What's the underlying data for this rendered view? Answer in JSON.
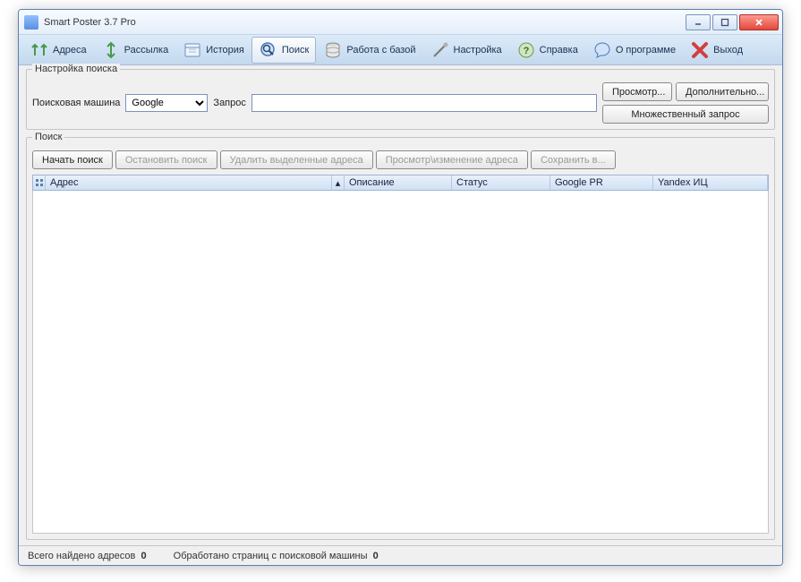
{
  "window": {
    "title": "Smart Poster 3.7 Pro"
  },
  "toolbar": {
    "addresses": "Адреса",
    "mailing": "Рассылка",
    "history": "История",
    "search": "Поиск",
    "database": "Работа с базой",
    "settings": "Настройка",
    "help": "Справка",
    "about": "О программе",
    "exit": "Выход"
  },
  "search_settings": {
    "group_title": "Настройка поиска",
    "engine_label": "Поисковая машина",
    "engine_value": "Google",
    "query_label": "Запрос",
    "query_value": "",
    "browse": "Просмотр...",
    "additional": "Дополнительно...",
    "multi_query": "Множественный запрос"
  },
  "search": {
    "group_title": "Поиск",
    "start": "Начать поиск",
    "stop": "Остановить поиск",
    "delete": "Удалить выделенные адреса",
    "view_change": "Просмотр\\изменение адреса",
    "save": "Сохранить в..."
  },
  "columns": {
    "address": "Адрес",
    "description": "Описание",
    "status": "Статус",
    "google_pr": "Google PR",
    "yandex_ic": "Yandex ИЦ"
  },
  "status": {
    "found_label": "Всего найдено адресов",
    "found_count": "0",
    "processed_label": "Обработано страниц с поисковой машины",
    "processed_count": "0"
  }
}
